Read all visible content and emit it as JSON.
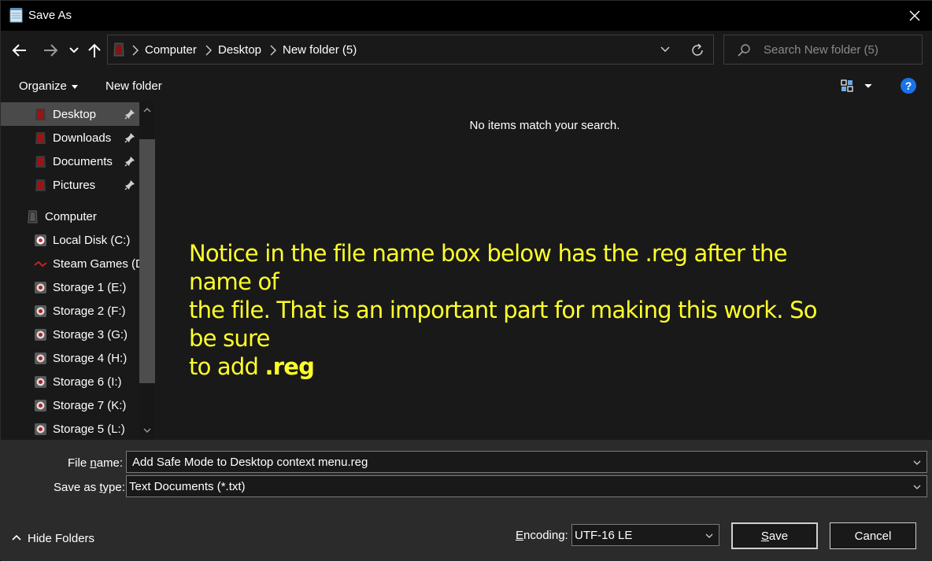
{
  "window": {
    "title": "Save As"
  },
  "address": {
    "crumbs": [
      "Computer",
      "Desktop",
      "New folder (5)"
    ]
  },
  "search": {
    "placeholder": "Search New folder (5)"
  },
  "toolbar": {
    "organize_label": "Organize",
    "new_folder_label": "New folder",
    "help_label": "?"
  },
  "sidebar": {
    "items": [
      {
        "label": "Desktop",
        "icon": "desktop-icon",
        "pinned": true,
        "selected": true
      },
      {
        "label": "Downloads",
        "icon": "downloads-icon",
        "pinned": true
      },
      {
        "label": "Documents",
        "icon": "documents-icon",
        "pinned": true
      },
      {
        "label": "Pictures",
        "icon": "pictures-icon",
        "pinned": true
      },
      {
        "label": "Computer",
        "icon": "computer-icon"
      },
      {
        "label": "Local Disk (C:)",
        "icon": "drive-icon"
      },
      {
        "label": "Steam Games (D",
        "icon": "drive-icon"
      },
      {
        "label": "Storage 1 (E:)",
        "icon": "drive-icon"
      },
      {
        "label": "Storage 2 (F:)",
        "icon": "drive-icon"
      },
      {
        "label": "Storage 3 (G:)",
        "icon": "drive-icon"
      },
      {
        "label": "Storage 4 (H:)",
        "icon": "drive-icon"
      },
      {
        "label": "Storage 6 (I:)",
        "icon": "drive-icon"
      },
      {
        "label": "Storage 7 (K:)",
        "icon": "drive-icon"
      },
      {
        "label": "Storage 5 (L:)",
        "icon": "drive-icon"
      }
    ]
  },
  "content": {
    "empty_message": "No items match your search.",
    "annotation_line1": "Notice in the file name box below has the .reg after the name of",
    "annotation_line2": "the file. That is an important part for making this work. So be sure",
    "annotation_line3": "to add ",
    "annotation_bold": ".reg"
  },
  "form": {
    "filename_label_pre": "File ",
    "filename_label_u": "n",
    "filename_label_post": "ame:",
    "filename_value": "Add Safe Mode to Desktop context menu.reg",
    "savetype_label_pre": "Save as ",
    "savetype_label_u": "t",
    "savetype_label_post": "ype:",
    "savetype_value": "Text Documents (*.txt)",
    "encoding_label_u": "E",
    "encoding_label_post": "ncoding:",
    "encoding_value": "UTF-16 LE"
  },
  "footer": {
    "hide_folders_label": "Hide Folders",
    "save_label_u": "S",
    "save_label_post": "ave",
    "cancel_label": "Cancel"
  },
  "colors": {
    "annotation": "#ffff2b",
    "help_accent": "#1a73e8",
    "background": "#191919",
    "bottom_panel": "#2b2b2b"
  }
}
